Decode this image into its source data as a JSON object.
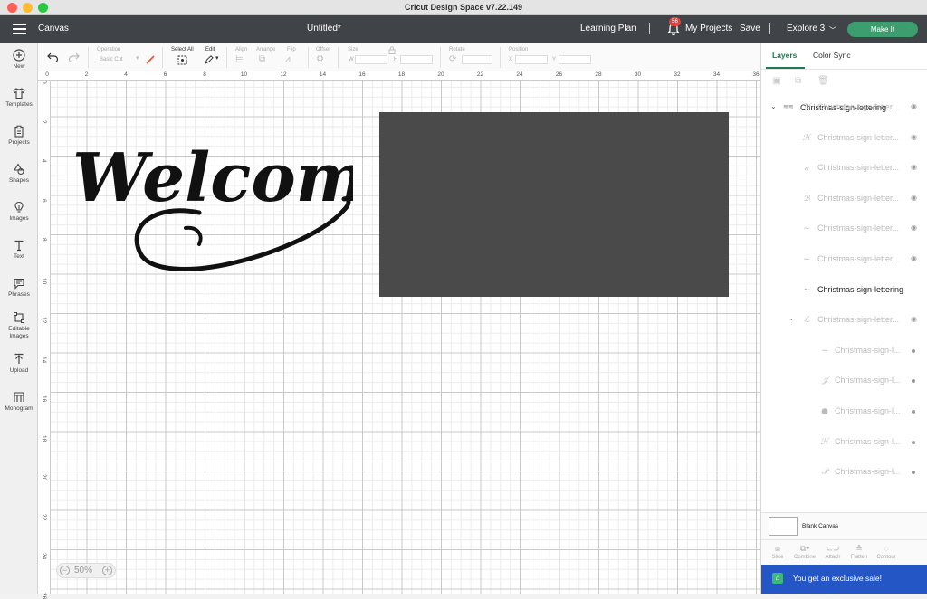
{
  "window": {
    "title": "Cricut Design Space  v7.22.149"
  },
  "header": {
    "canvas_label": "Canvas",
    "doc_title": "Untitled*",
    "learning_plan": "Learning Plan",
    "separator": "|",
    "notification_count": "56",
    "my_projects": "My Projects",
    "save": "Save",
    "explore": "Explore 3",
    "make_it": "Make It"
  },
  "leftbar": {
    "items": [
      {
        "label": "New",
        "icon": "plus-circle-icon"
      },
      {
        "label": "Templates",
        "icon": "shirt-icon"
      },
      {
        "label": "Projects",
        "icon": "clipboard-icon"
      },
      {
        "label": "Shapes",
        "icon": "shapes-icon"
      },
      {
        "label": "Images",
        "icon": "bulb-icon"
      },
      {
        "label": "Text",
        "icon": "text-icon"
      },
      {
        "label": "Phrases",
        "icon": "speech-bubble-icon"
      },
      {
        "label": "Editable Images",
        "icon": "editable-images-icon"
      },
      {
        "label": "Upload",
        "icon": "upload-icon"
      },
      {
        "label": "Monogram",
        "icon": "monogram-icon"
      }
    ]
  },
  "toolbar": {
    "operation_label": "Operation",
    "operation_value": "Basic Cut",
    "select_all": "Select All",
    "edit": "Edit",
    "align": "Align",
    "arrange": "Arrange",
    "flip": "Flip",
    "offset": "Offset",
    "size": "Size",
    "size_w": "W",
    "size_h": "H",
    "rotate": "Rotate",
    "position": "Position",
    "pos_x": "X",
    "pos_y": "Y"
  },
  "ruler": {
    "top": [
      "0",
      "2",
      "4",
      "6",
      "8",
      "10",
      "12",
      "14",
      "16",
      "18",
      "20",
      "22",
      "24",
      "26",
      "28",
      "30",
      "32",
      "34",
      "36"
    ],
    "left": [
      "0",
      "2",
      "4",
      "6",
      "8",
      "10",
      "12",
      "14",
      "16",
      "18",
      "20",
      "22",
      "24",
      "26"
    ]
  },
  "canvas": {
    "zoom": "50%",
    "zoom_minus": "−",
    "zoom_plus": "+",
    "artwork_text": "Welcome"
  },
  "layers_panel": {
    "tab_layers": "Layers",
    "tab_color_sync": "Color Sync",
    "group_name": "Christmas-sign-lettering",
    "rows": [
      {
        "name": "Christmas-sign-letter...",
        "thumb": "ℳ",
        "style": "faded"
      },
      {
        "name": "Christmas-sign-letter...",
        "thumb": "ℋ",
        "style": "faded"
      },
      {
        "name": "Christmas-sign-letter...",
        "thumb": "𝒶",
        "style": "faded"
      },
      {
        "name": "Christmas-sign-letter...",
        "thumb": "ℬ",
        "style": "faded"
      },
      {
        "name": "Christmas-sign-letter...",
        "thumb": "~",
        "style": "faded"
      },
      {
        "name": "Christmas-sign-letter...",
        "thumb": "~",
        "style": "faded"
      },
      {
        "name": "Christmas-sign-lettering",
        "thumb": "~",
        "style": "active"
      },
      {
        "name": "Christmas-sign-letter...",
        "thumb": "ℒ",
        "style": "faded-group"
      },
      {
        "name": "Christmas-sign-l...",
        "thumb": "~",
        "style": "child"
      },
      {
        "name": "Christmas-sign-l...",
        "thumb": "𝒥",
        "style": "child"
      },
      {
        "name": "Christmas-sign-l...",
        "thumb": "●",
        "style": "child"
      },
      {
        "name": "Christmas-sign-l...",
        "thumb": "ℋ",
        "style": "child"
      },
      {
        "name": "Christmas-sign-l...",
        "thumb": "𝒫",
        "style": "child"
      }
    ],
    "blank_canvas": "Blank Canvas",
    "actions": [
      {
        "label": "Slice",
        "icon": "slice-icon"
      },
      {
        "label": "Combine",
        "icon": "combine-icon"
      },
      {
        "label": "Attach",
        "icon": "attach-icon"
      },
      {
        "label": "Flatten",
        "icon": "flatten-icon"
      },
      {
        "label": "Contour",
        "icon": "contour-icon"
      }
    ],
    "sale_banner": "You get an exclusive sale!"
  },
  "colors": {
    "header_bg": "#404347",
    "make_it": "#3c9e6e",
    "accent_green": "#1f7a54",
    "sale_banner": "#2456c6",
    "canvas_rect": "#4a4a4a"
  }
}
